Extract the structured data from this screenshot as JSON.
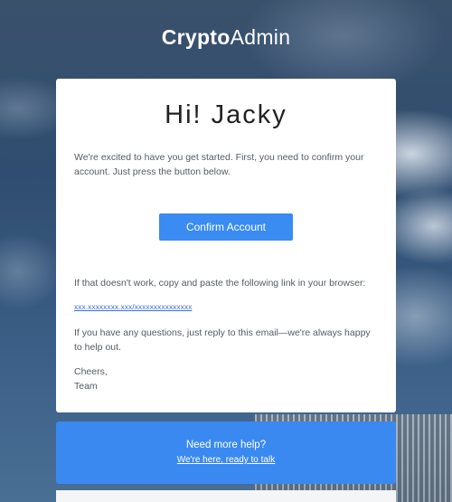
{
  "brand": {
    "bold": "Crypto",
    "light": "Admin"
  },
  "card": {
    "greeting": "Hi! Jacky",
    "intro": "We're excited to have you get started. First, you need to confirm your account. Just press the button below.",
    "confirm_button": "Confirm Account",
    "fallback_text": "If that doesn't work, copy and paste the following link in your browser:",
    "link": "xxx.xxxxxxxx.xxx/xxxxxxxxxxxxxxx",
    "questions_text": "If you have any questions, just reply to this email—we're always happy to help out.",
    "signoff": "Cheers,",
    "signature": "Team"
  },
  "help": {
    "title": "Need more help?",
    "link_text": "We're here, ready to talk"
  },
  "colors": {
    "accent": "#3a8bf2",
    "card_bg": "#ffffff"
  }
}
